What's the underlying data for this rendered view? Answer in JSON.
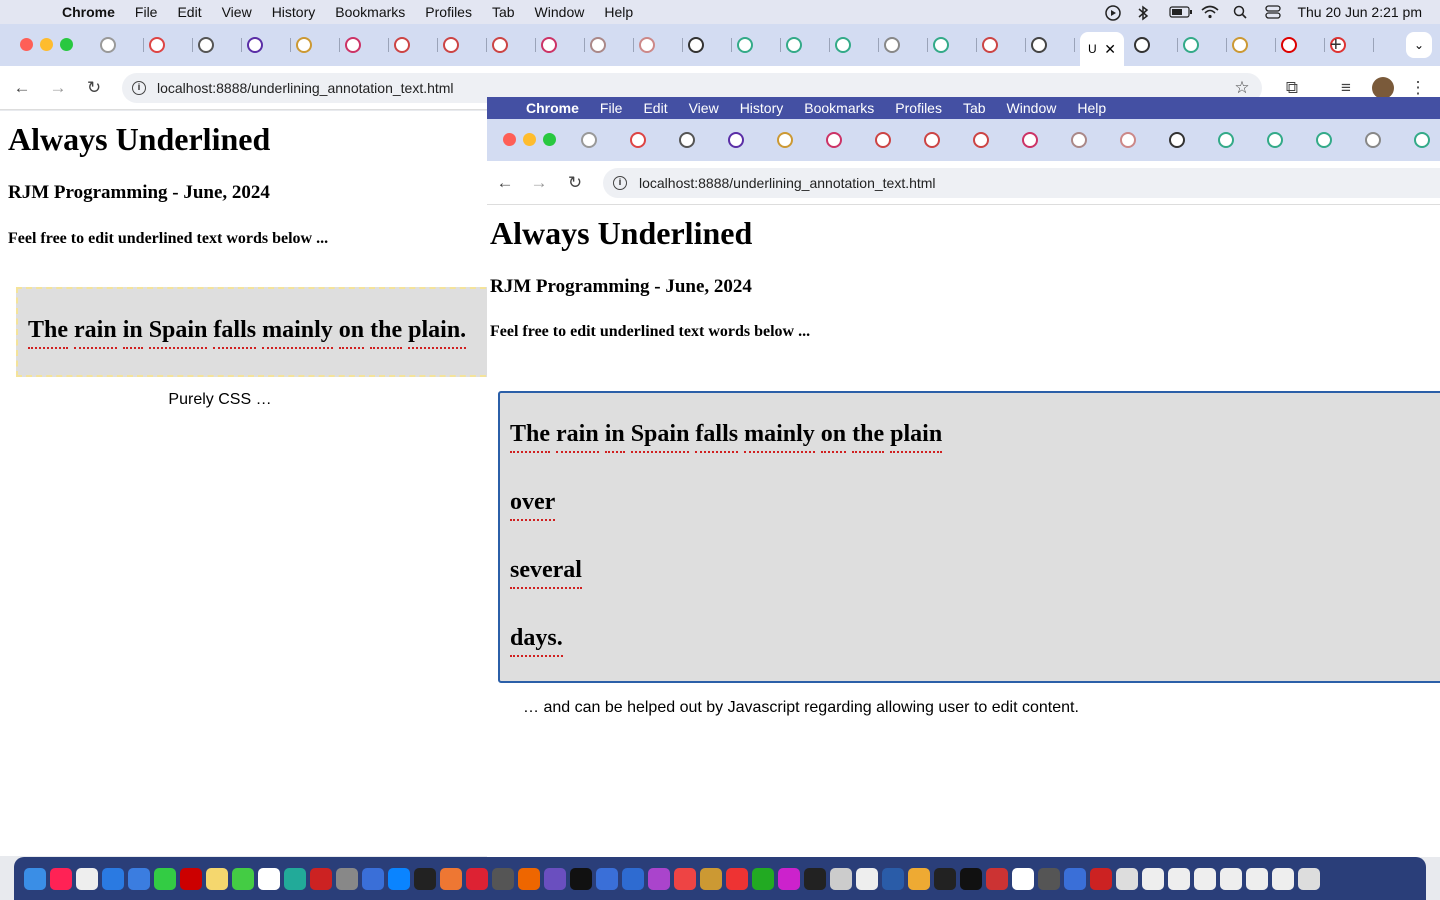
{
  "menubar": {
    "app": "Chrome",
    "items": [
      "File",
      "Edit",
      "View",
      "History",
      "Bookmarks",
      "Profiles",
      "Tab",
      "Window",
      "Help"
    ],
    "clock": "Thu 20 Jun  2:21 pm"
  },
  "browser": {
    "url": "localhost:8888/underlining_annotation_text.html",
    "tab_count": 28,
    "active_tab_label": "U"
  },
  "page": {
    "title": "Always Underlined",
    "subtitle": "RJM Programming - June, 2024",
    "instruction": "Feel free to edit underlined text words below ...",
    "left_words": [
      "The",
      "rain",
      "in",
      "Spain",
      "falls",
      "mainly",
      "on",
      "the",
      "plain."
    ],
    "left_caption": "Purely CSS …"
  },
  "overlay": {
    "menubar": {
      "app": "Chrome",
      "items": [
        "File",
        "Edit",
        "View",
        "History",
        "Bookmarks",
        "Profiles",
        "Tab",
        "Window",
        "Help"
      ]
    },
    "url": "localhost:8888/underlining_annotation_text.html",
    "title": "Always Underlined",
    "subtitle": "RJM Programming - June, 2024",
    "instruction": "Feel free to edit underlined text words below ...",
    "lines": [
      [
        "The",
        "rain",
        "in",
        "Spain",
        "falls",
        "mainly",
        "on",
        "the",
        "plain"
      ],
      [
        "over"
      ],
      [
        "several"
      ],
      [
        "days."
      ]
    ],
    "caption": "… and can be helped out by Javascript regarding allowing user to edit content."
  },
  "colors": {
    "underline": "#d02020",
    "box_bg": "#dedede",
    "overlay_menubar": "#4450a3",
    "tabstrip": "#d3dcf2"
  }
}
